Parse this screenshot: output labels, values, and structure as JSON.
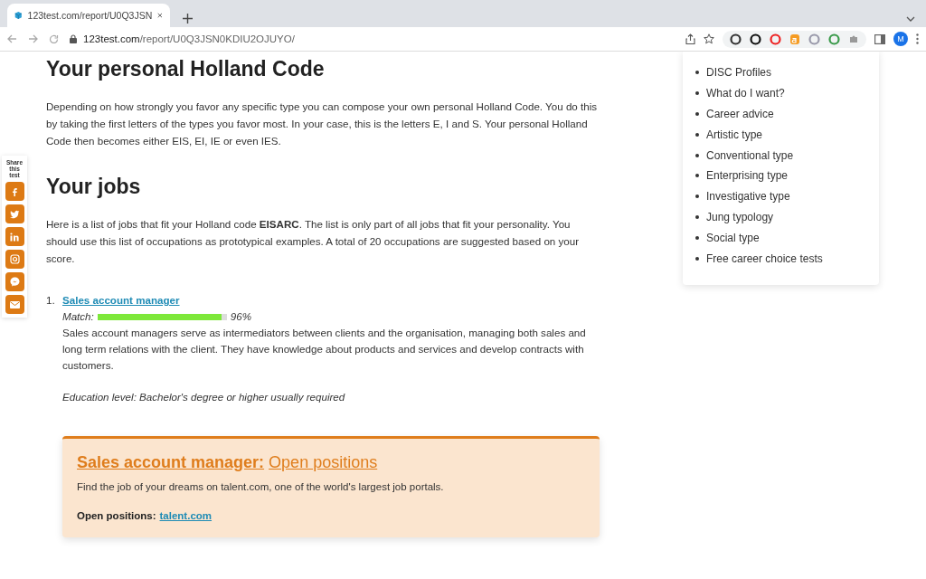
{
  "browser": {
    "tab": {
      "title": "123test.com/report/U0Q3JSN",
      "selected": true
    },
    "address": {
      "domain": "123test.com",
      "path": "/report/U0Q3JSN0KDIU2OJUYO/"
    },
    "profile_initial": "M"
  },
  "share": {
    "label": "Share this test",
    "buttons": [
      {
        "kind": "facebook"
      },
      {
        "kind": "twitter"
      },
      {
        "kind": "linkedin"
      },
      {
        "kind": "instagram"
      },
      {
        "kind": "messenger"
      },
      {
        "kind": "email"
      }
    ]
  },
  "sections": [
    {
      "heading": "Your personal Holland Code",
      "text": "Depending on how strongly you favor any specific type you can compose your own personal Holland Code. You do this by taking the first letters of the types you favor most. In your case, this is the letters E, I and S. Your personal Holland Code then becomes either EIS, EI, IE or even IES."
    },
    {
      "heading": "Your jobs",
      "text": "Here is a list of jobs that fit your Holland code **EISARC**. The list is only part of all jobs that fit your personality. You should use this list of occupations as prototypical examples. A total of 20 occupations are suggested based on your score."
    }
  ],
  "jobs": [
    {
      "number": "1.",
      "title": "Sales account manager",
      "match_label": "Match:",
      "level": 0.96,
      "reading": "96%",
      "description": "Sales account managers serve as intermediators between clients and the organisation, managing both sales and long term relations with the client. They have knowledge about products and services and develop contracts with customers.",
      "education": "Education level: Bachelor's degree or higher usually required"
    }
  ],
  "positions_box": {
    "title_bold": "Sales account manager:",
    "title_link": "Open positions",
    "text": "Find the job of your dreams on talent.com, one of the world's largest job portals.",
    "label": "Open positions:",
    "link": "talent.com"
  },
  "sidebar": {
    "items": [
      "DISC Profiles",
      "What do I want?",
      "Career advice",
      "Artistic type",
      "Conventional type",
      "Enterprising type",
      "Investigative type",
      "Jung typology",
      "Social type",
      "Free career choice tests"
    ]
  }
}
